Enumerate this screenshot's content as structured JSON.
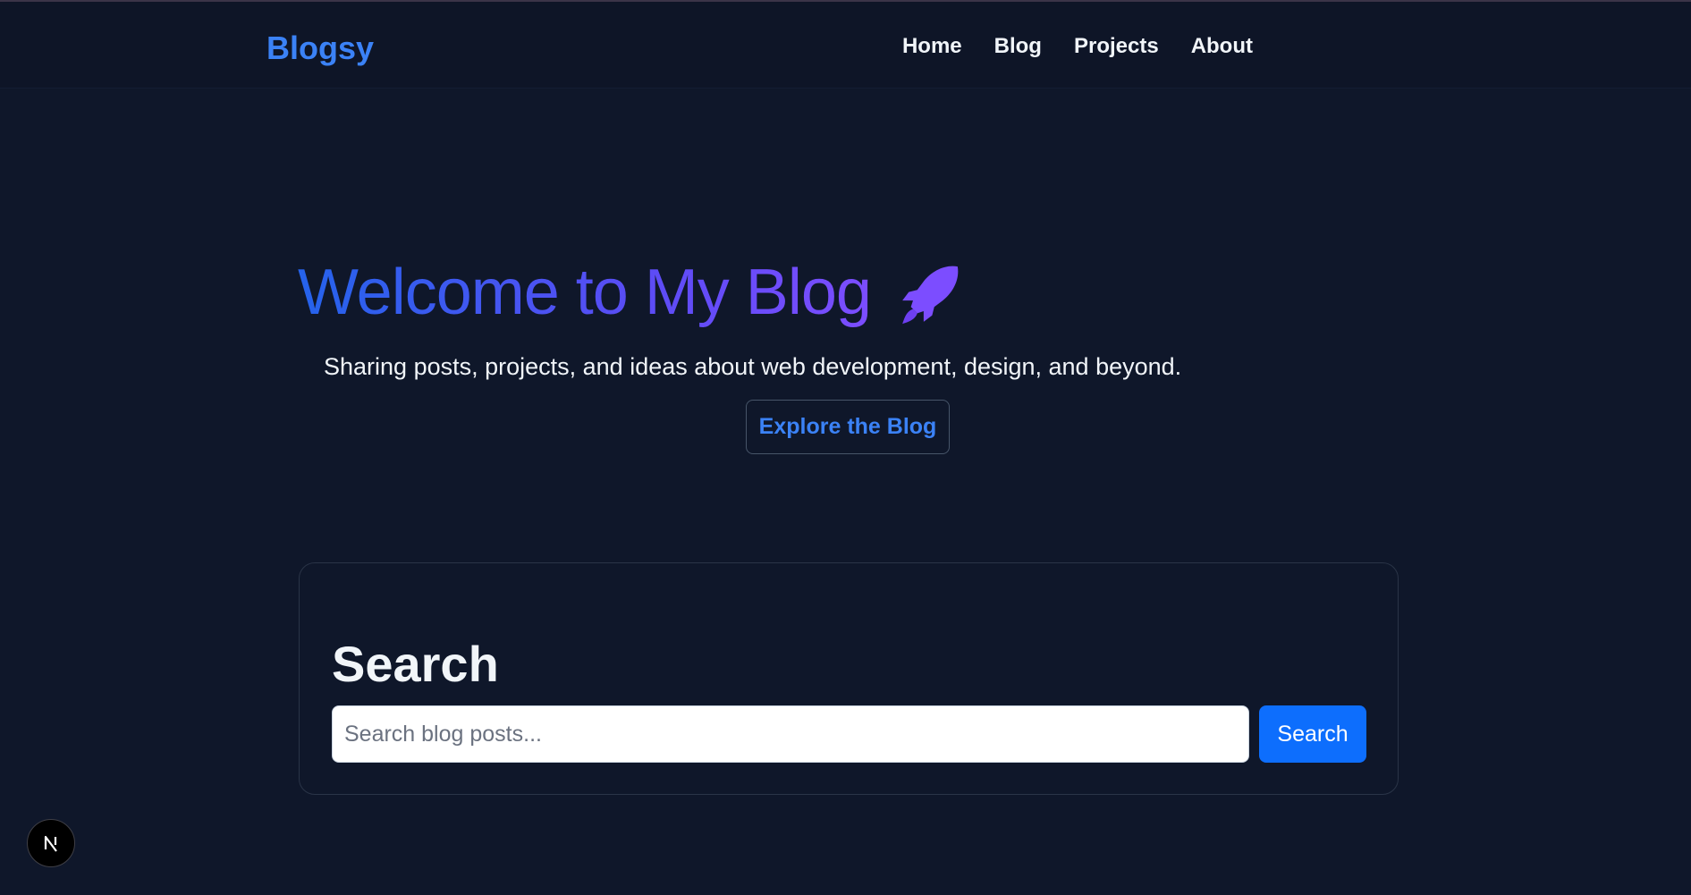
{
  "header": {
    "brand": "Blogsy",
    "nav": {
      "home": "Home",
      "blog": "Blog",
      "projects": "Projects",
      "about": "About"
    }
  },
  "hero": {
    "title": "Welcome to My Blog",
    "title_icon": "rocket-icon",
    "subtitle": "Sharing posts, projects, and ideas about web development, design, and beyond.",
    "cta_label": "Explore the Blog"
  },
  "search": {
    "heading": "Search",
    "placeholder": "Search blog posts...",
    "button_label": "Search"
  },
  "floating_badge": {
    "icon": "nextjs-n-icon"
  },
  "colors": {
    "background": "#0f172a",
    "accent": "#3b82f6",
    "gradient_start": "#2563eb",
    "gradient_end": "#7c4dff",
    "primary_button": "#0d6efd"
  }
}
